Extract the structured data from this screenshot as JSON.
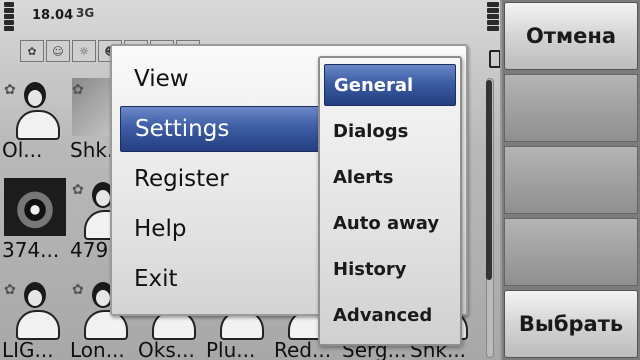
{
  "status": {
    "time": "18.04",
    "network": "3G"
  },
  "toolbar_icons": [
    "flowers-icon",
    "contact-icon",
    "lightbulb-icon",
    "person-icon",
    "circle-icon",
    "circle-icon",
    "grid-icon"
  ],
  "contacts": [
    {
      "name": "Ol...",
      "pic": "default-avatar"
    },
    {
      "name": "Shk...",
      "pic": "cartoon-photo"
    },
    {
      "name": "374...",
      "pic": "eye-photo"
    },
    {
      "name": "479...",
      "pic": "default-avatar"
    },
    {
      "name": "LIG...",
      "pic": "default-avatar"
    },
    {
      "name": "Lon...",
      "pic": "default-avatar"
    },
    {
      "name": "Oks...",
      "pic": "default-avatar"
    },
    {
      "name": "Plu...",
      "pic": "default-avatar"
    },
    {
      "name": "Red...",
      "pic": "default-avatar"
    },
    {
      "name": "Serg...",
      "pic": "default-avatar"
    },
    {
      "name": "Shk...",
      "pic": "default-avatar"
    }
  ],
  "menu": {
    "items": [
      {
        "label": "View"
      },
      {
        "label": "Settings",
        "selected": true
      },
      {
        "label": "Register"
      },
      {
        "label": "Help"
      },
      {
        "label": "Exit"
      }
    ]
  },
  "submenu": {
    "items": [
      {
        "label": "General",
        "selected": true
      },
      {
        "label": "Dialogs"
      },
      {
        "label": "Alerts"
      },
      {
        "label": "Auto away"
      },
      {
        "label": "History"
      },
      {
        "label": "Advanced"
      }
    ]
  },
  "softkeys": {
    "cancel": "Отмена",
    "select": "Выбрать"
  },
  "colors": {
    "highlight": "#3e5ea6",
    "popup_bg": "#f0f0f0"
  }
}
